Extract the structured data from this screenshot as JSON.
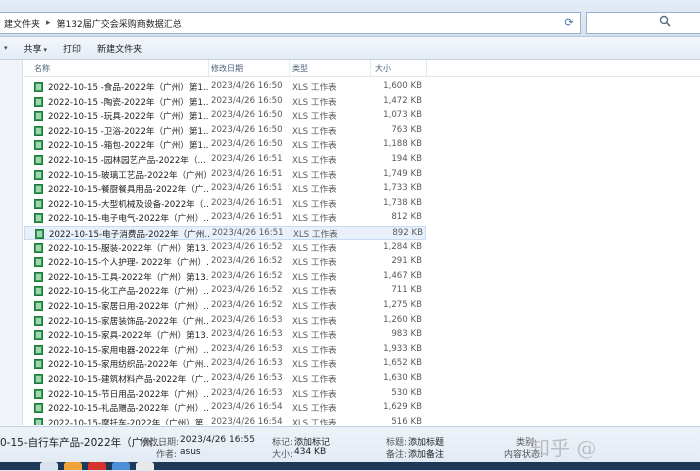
{
  "address_bar": {
    "crumbs": [
      "建文件夹",
      "第132届广交会采购商数据汇总"
    ],
    "search_placeholder": ""
  },
  "toolbar": {
    "share_label": "共享",
    "print_label": "打印",
    "new_folder_label": "新建文件夹"
  },
  "nav_pane": {
    "partial_label": "​"
  },
  "columns": {
    "name": "名称",
    "date": "修改日期",
    "type": "类型",
    "size": "大小"
  },
  "files": [
    {
      "name": "2022-10-15 -食品-2022年（广州）第1...",
      "date": "2023/4/26 16:50",
      "type": "XLS 工作表",
      "size": "1,600 KB"
    },
    {
      "name": "2022-10-15 -陶瓷-2022年（广州）第1...",
      "date": "2023/4/26 16:50",
      "type": "XLS 工作表",
      "size": "1,472 KB"
    },
    {
      "name": "2022-10-15 -玩具-2022年（广州）第1...",
      "date": "2023/4/26 16:50",
      "type": "XLS 工作表",
      "size": "1,073 KB"
    },
    {
      "name": "2022-10-15 -卫浴-2022年（广州）第1...",
      "date": "2023/4/26 16:50",
      "type": "XLS 工作表",
      "size": "763 KB"
    },
    {
      "name": "2022-10-15 -箱包-2022年（广州）第1...",
      "date": "2023/4/26 16:50",
      "type": "XLS 工作表",
      "size": "1,188 KB"
    },
    {
      "name": "2022-10-15 -园林园艺产品-2022年（...",
      "date": "2023/4/26 16:51",
      "type": "XLS 工作表",
      "size": "194 KB"
    },
    {
      "name": "2022-10-15-玻璃工艺品-2022年（广州）",
      "date": "2023/4/26 16:51",
      "type": "XLS 工作表",
      "size": "1,749 KB"
    },
    {
      "name": "2022-10-15-餐厨餐具用品-2022年（广...",
      "date": "2023/4/26 16:51",
      "type": "XLS 工作表",
      "size": "1,733 KB"
    },
    {
      "name": "2022-10-15-大型机械及设备-2022年（...",
      "date": "2023/4/26 16:51",
      "type": "XLS 工作表",
      "size": "1,738 KB"
    },
    {
      "name": "2022-10-15-电子电气-2022年（广州）...",
      "date": "2023/4/26 16:51",
      "type": "XLS 工作表",
      "size": "812 KB"
    },
    {
      "name": "2022-10-15-电子消费品-2022年（广州...",
      "date": "2023/4/26 16:51",
      "type": "XLS 工作表",
      "size": "892 KB"
    },
    {
      "name": "2022-10-15-服装-2022年（广州）第13...",
      "date": "2023/4/26 16:52",
      "type": "XLS 工作表",
      "size": "1,284 KB"
    },
    {
      "name": "2022-10-15-个人护理- 2022年（广州）...",
      "date": "2023/4/26 16:52",
      "type": "XLS 工作表",
      "size": "291 KB"
    },
    {
      "name": "2022-10-15-工具-2022年（广州）第13...",
      "date": "2023/4/26 16:52",
      "type": "XLS 工作表",
      "size": "1,467 KB"
    },
    {
      "name": "2022-10-15-化工产品-2022年（广州）...",
      "date": "2023/4/26 16:52",
      "type": "XLS 工作表",
      "size": "711 KB"
    },
    {
      "name": "2022-10-15-家居日用-2022年（广州）...",
      "date": "2023/4/26 16:52",
      "type": "XLS 工作表",
      "size": "1,275 KB"
    },
    {
      "name": "2022-10-15-家居装饰品-2022年（广州...",
      "date": "2023/4/26 16:53",
      "type": "XLS 工作表",
      "size": "1,260 KB"
    },
    {
      "name": "2022-10-15-家具-2022年（广州）第13...",
      "date": "2023/4/26 16:53",
      "type": "XLS 工作表",
      "size": "983 KB"
    },
    {
      "name": "2022-10-15-家用电器-2022年（广州）...",
      "date": "2023/4/26 16:53",
      "type": "XLS 工作表",
      "size": "1,933 KB"
    },
    {
      "name": "2022-10-15-家用纺织品-2022年（广州...",
      "date": "2023/4/26 16:53",
      "type": "XLS 工作表",
      "size": "1,652 KB"
    },
    {
      "name": "2022-10-15-建筑材料产品-2022年（广...",
      "date": "2023/4/26 16:53",
      "type": "XLS 工作表",
      "size": "1,630 KB"
    },
    {
      "name": "2022-10-15-节日用品-2022年（广州）...",
      "date": "2023/4/26 16:53",
      "type": "XLS 工作表",
      "size": "530 KB"
    },
    {
      "name": "2022-10-15-礼品赠品-2022年（广州）...",
      "date": "2023/4/26 16:54",
      "type": "XLS 工作表",
      "size": "1,629 KB"
    },
    {
      "name": "2022-10-15-摩托车-2022年（广州）第...",
      "date": "2023/4/26 16:54",
      "type": "XLS 工作表",
      "size": "516 KB"
    }
  ],
  "details": {
    "title": "0-15-自行车产品-2022年（广州...",
    "modified_key": "修改日期:",
    "modified_val": "2023/4/26 16:55",
    "author_key": "作者:",
    "author_val": "asus",
    "tags_key": "标记:",
    "tags_val": "添加标记",
    "size_key": "大小:",
    "size_val": "434 KB",
    "title_key": "标题:",
    "title_val": "添加标题",
    "remarks_key": "备注:",
    "remarks_val": "添加备注",
    "category_key": "类别:",
    "status_key": "内容状态:"
  },
  "colors": {
    "excel_green": "#2d9e4f",
    "selection": "#e8f1fb",
    "toolbar": "#e3ebf5",
    "taskbar": "#1f3858"
  }
}
